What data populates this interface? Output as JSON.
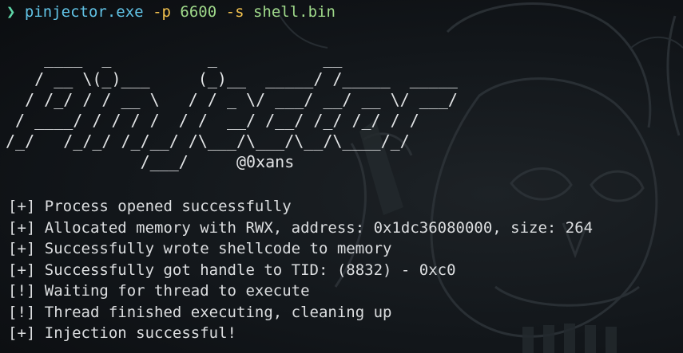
{
  "window": {
    "background_color": "#0e1114",
    "wallpaper_tint": "#2b3136"
  },
  "prompt": {
    "symbol": "❯",
    "executable": "pinjector.exe",
    "flag_p": "-p",
    "pid": "6600",
    "flag_s": "-s",
    "shellcode_file": "shell.bin",
    "colors": {
      "symbol": "#5fd7a8",
      "executable": "#61c3e6",
      "flag": "#f2c14e",
      "argument": "#9fd98a"
    }
  },
  "banner": {
    "ascii_art": "    ____  _          _           __\n   / __ \\(_)___     (_)__  _____/ /_____  _____\n  / /_/ / / __ \\   / / _ \\/ ___/ __/ __ \\/ ___/\n / ____/ / / / /  / /  __/ /__/ /_/ /_/ / /\n/_/   /_/_/ /_/__/ /\\___/\\___/\\__/\\____/_/\n              /___/     @0xans"
  },
  "log": [
    {
      "tag": "[+]",
      "message": "Process opened successfully"
    },
    {
      "tag": "[+]",
      "message": "Allocated memory with RWX, address: 0x1dc36080000, size: 264"
    },
    {
      "tag": "[+]",
      "message": "Successfully wrote shellcode to memory"
    },
    {
      "tag": "[+]",
      "message": "Successfully got handle to TID: (8832) - 0xc0"
    },
    {
      "tag": "[!]",
      "message": "Waiting for thread to execute"
    },
    {
      "tag": "[!]",
      "message": "Thread finished executing, cleaning up"
    },
    {
      "tag": "[+]",
      "message": "Injection successful!"
    }
  ]
}
